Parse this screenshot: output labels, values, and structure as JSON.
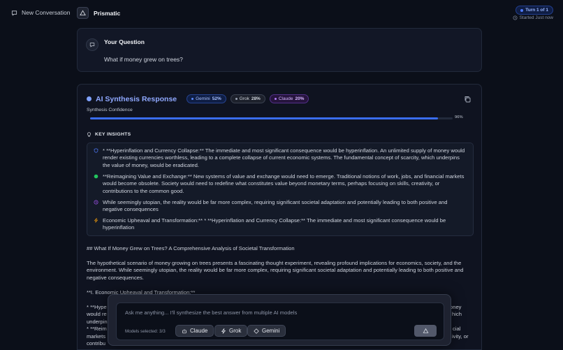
{
  "topbar": {
    "new_conversation": "New Conversation",
    "app_name": "Prismatic",
    "turn_badge": "Turn 1 of 1",
    "started": "Started Just now"
  },
  "question": {
    "title": "Your Question",
    "text": "What if money grew on trees?"
  },
  "synthesis": {
    "title": "AI Synthesis Response",
    "models": [
      {
        "name": "Gemini",
        "percent": "52%"
      },
      {
        "name": "Grok",
        "percent": "28%"
      },
      {
        "name": "Claude",
        "percent": "20%"
      }
    ],
    "confidence_label": "Synthesis Confidence",
    "confidence_value": "96%",
    "confidence_fraction": 0.96
  },
  "key_insights": {
    "header": "KEY INSIGHTS",
    "items": [
      {
        "icon": "shield-icon",
        "color": "#4f7cff",
        "text": "* **Hyperinflation and Currency Collapse:** The immediate and most significant consequence would be hyperinflation. An unlimited supply of money would render existing currencies worthless, leading to a complete collapse of current economic systems. The fundamental concept of scarcity, which underpins the value of money, would be eradicated."
      },
      {
        "icon": "circle-dot-icon",
        "color": "#22c55e",
        "text": "**Reimagining Value and Exchange:** New systems of value and exchange would need to emerge. Traditional notions of work, jobs, and financial markets would become obsolete. Society would need to redefine what constitutes value beyond monetary terms, perhaps focusing on skills, creativity, or contributions to the common good."
      },
      {
        "icon": "clock-icon",
        "color": "#a855f7",
        "text": "While seemingly utopian, the reality would be far more complex, requiring significant societal adaptation and potentially leading to both positive and negative consequences"
      },
      {
        "icon": "lightning-icon",
        "color": "#f59e0b",
        "text": "Economic Upheaval and Transformation:** * **Hyperinflation and Currency Collapse:** The immediate and most significant consequence would be hyperinflation"
      }
    ]
  },
  "body": {
    "heading": "## What If Money Grew on Trees? A Comprehensive Analysis of Societal Transformation",
    "paragraph": "The hypothetical scenario of money growing on trees presents a fascinating thought experiment, revealing profound implications for economics, society, and the environment. While seemingly utopian, the reality would be far more complex, requiring significant societal adaptation and potentially leading to both positive and negative consequences.",
    "section": "**I. Economic Upheaval and Transformation:**",
    "partial_1": "* **Hype",
    "partial_1_right": "oney",
    "partial_2": "would re",
    "partial_2_right": "hich",
    "partial_3": "underpin",
    "partial_4": "* **Reim",
    "partial_4_right": "cial",
    "partial_5": "markets",
    "partial_5_right": "ivity, or",
    "partial_6": "contribu"
  },
  "composer": {
    "placeholder": "Ask me anything... I'll synthesize the best answer from multiple AI models",
    "models_selected": "Models selected: 3/3",
    "buttons": [
      "Claude",
      "Grok",
      "Gemini"
    ]
  }
}
